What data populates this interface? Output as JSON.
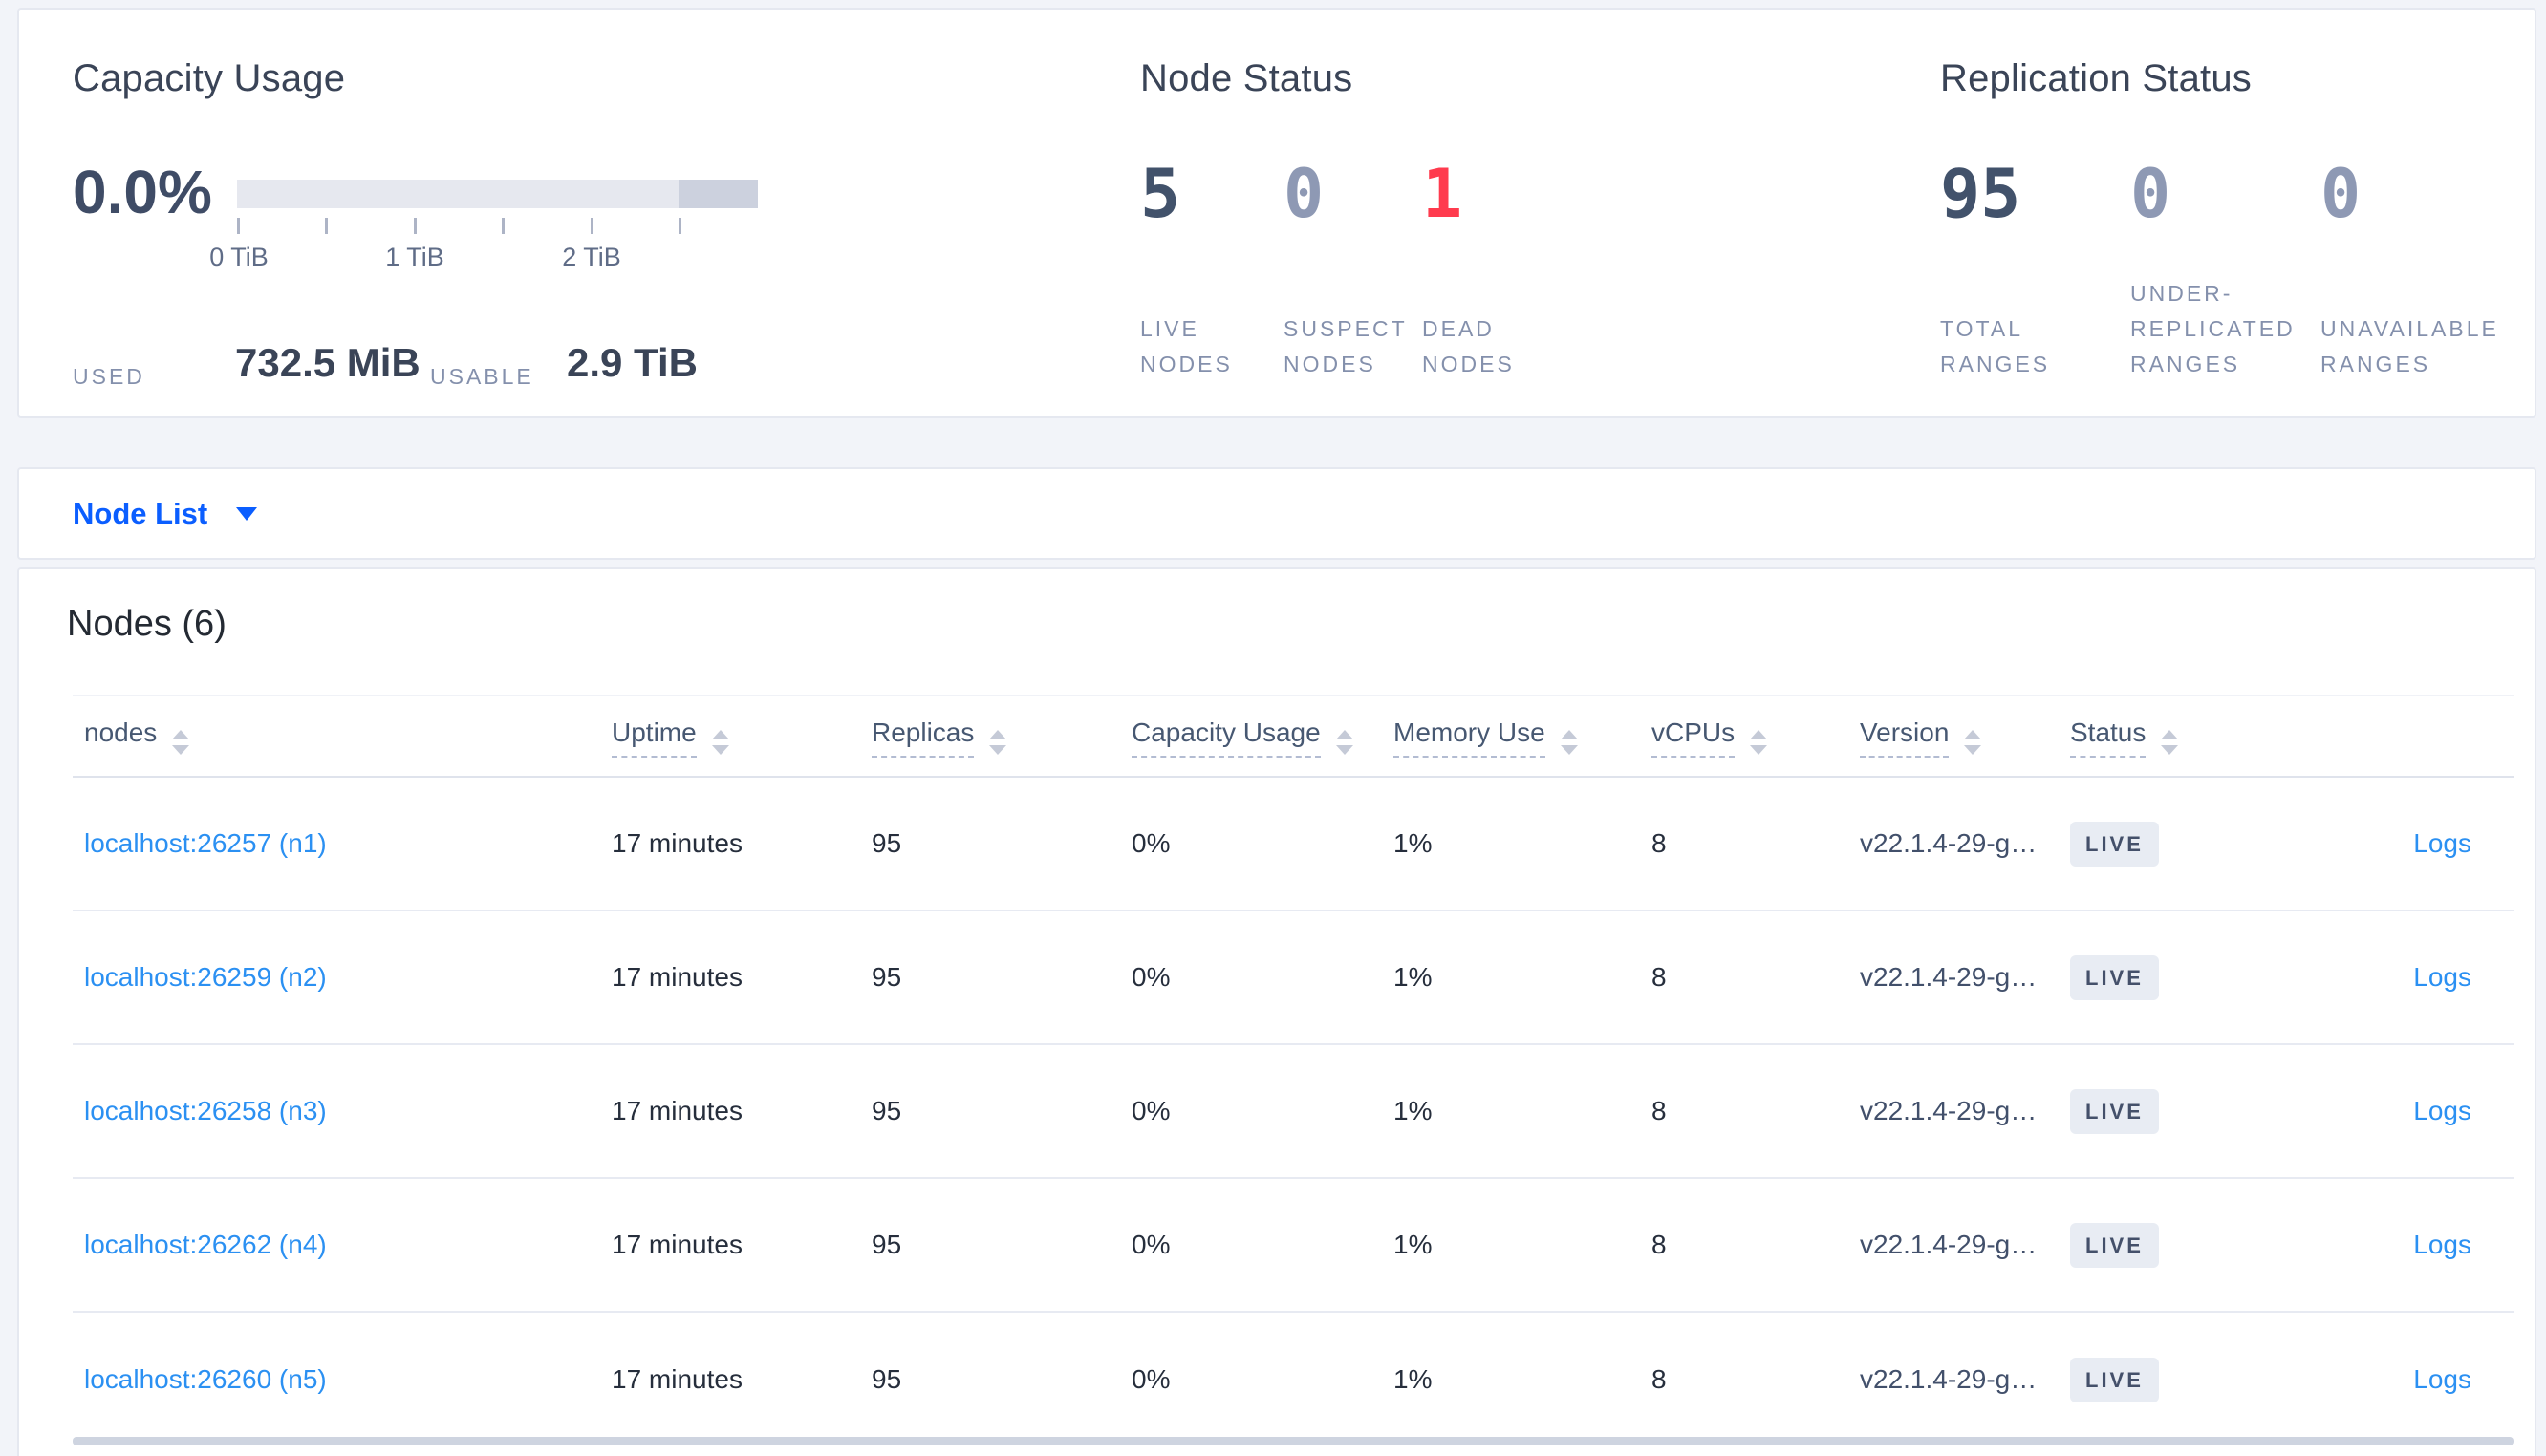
{
  "colors": {
    "page_bg": "#f2f4f9",
    "accent_blue": "#0b5eff",
    "link_blue": "#2b90f2",
    "dead_red": "#ff3b4e",
    "dark_number": "#42526b",
    "muted_number": "#8e99b4",
    "badge_bg": "#e8ecf3"
  },
  "summary": {
    "capacity": {
      "title": "Capacity Usage",
      "percent": "0.0%",
      "tick_labels": [
        "0 TiB",
        "1 TiB",
        "2 TiB"
      ],
      "used_label": "USED",
      "used_value": "732.5 MiB",
      "usable_label": "USABLE",
      "usable_value": "2.9 TiB"
    },
    "node_status": {
      "title": "Node Status",
      "stats": [
        {
          "value": "5",
          "label": "LIVE\nNODES"
        },
        {
          "value": "0",
          "label": "SUSPECT\nNODES"
        },
        {
          "value": "1",
          "label": "DEAD\nNODES"
        }
      ]
    },
    "replication": {
      "title": "Replication Status",
      "stats": [
        {
          "value": "95",
          "label": "TOTAL\nRANGES"
        },
        {
          "value": "0",
          "label": "UNDER-\nREPLICATED\nRANGES"
        },
        {
          "value": "0",
          "label": "UNAVAILABLE\nRANGES"
        }
      ]
    }
  },
  "node_list_bar": {
    "label": "Node List"
  },
  "nodes_section": {
    "title": "Nodes (6)",
    "columns": [
      {
        "label": "nodes"
      },
      {
        "label": "Uptime"
      },
      {
        "label": "Replicas"
      },
      {
        "label": "Capacity Usage"
      },
      {
        "label": "Memory Use"
      },
      {
        "label": "vCPUs"
      },
      {
        "label": "Version"
      },
      {
        "label": "Status"
      },
      {
        "label": ""
      }
    ],
    "rows": [
      {
        "address": "localhost:26257 (n1)",
        "uptime": "17 minutes",
        "replicas": "95",
        "capacity_usage": "0%",
        "memory_use": "1%",
        "vcpus": "8",
        "version": "v22.1.4-29-g…",
        "status": "LIVE",
        "logs": "Logs"
      },
      {
        "address": "localhost:26259 (n2)",
        "uptime": "17 minutes",
        "replicas": "95",
        "capacity_usage": "0%",
        "memory_use": "1%",
        "vcpus": "8",
        "version": "v22.1.4-29-g…",
        "status": "LIVE",
        "logs": "Logs"
      },
      {
        "address": "localhost:26258 (n3)",
        "uptime": "17 minutes",
        "replicas": "95",
        "capacity_usage": "0%",
        "memory_use": "1%",
        "vcpus": "8",
        "version": "v22.1.4-29-g…",
        "status": "LIVE",
        "logs": "Logs"
      },
      {
        "address": "localhost:26262 (n4)",
        "uptime": "17 minutes",
        "replicas": "95",
        "capacity_usage": "0%",
        "memory_use": "1%",
        "vcpus": "8",
        "version": "v22.1.4-29-g…",
        "status": "LIVE",
        "logs": "Logs"
      },
      {
        "address": "localhost:26260 (n5)",
        "uptime": "17 minutes",
        "replicas": "95",
        "capacity_usage": "0%",
        "memory_use": "1%",
        "vcpus": "8",
        "version": "v22.1.4-29-g…",
        "status": "LIVE",
        "logs": "Logs"
      }
    ]
  },
  "chart_data": {
    "type": "bar",
    "title": "Capacity Usage gauge",
    "used_percent": 0.0,
    "used": "732.5 MiB",
    "usable": "2.9 TiB",
    "axis_ticks_tib": [
      0,
      0.5,
      1,
      1.5,
      2,
      2.5
    ],
    "bar_extent_tib": 2.95,
    "light_segment_end_tib": 2.5
  }
}
